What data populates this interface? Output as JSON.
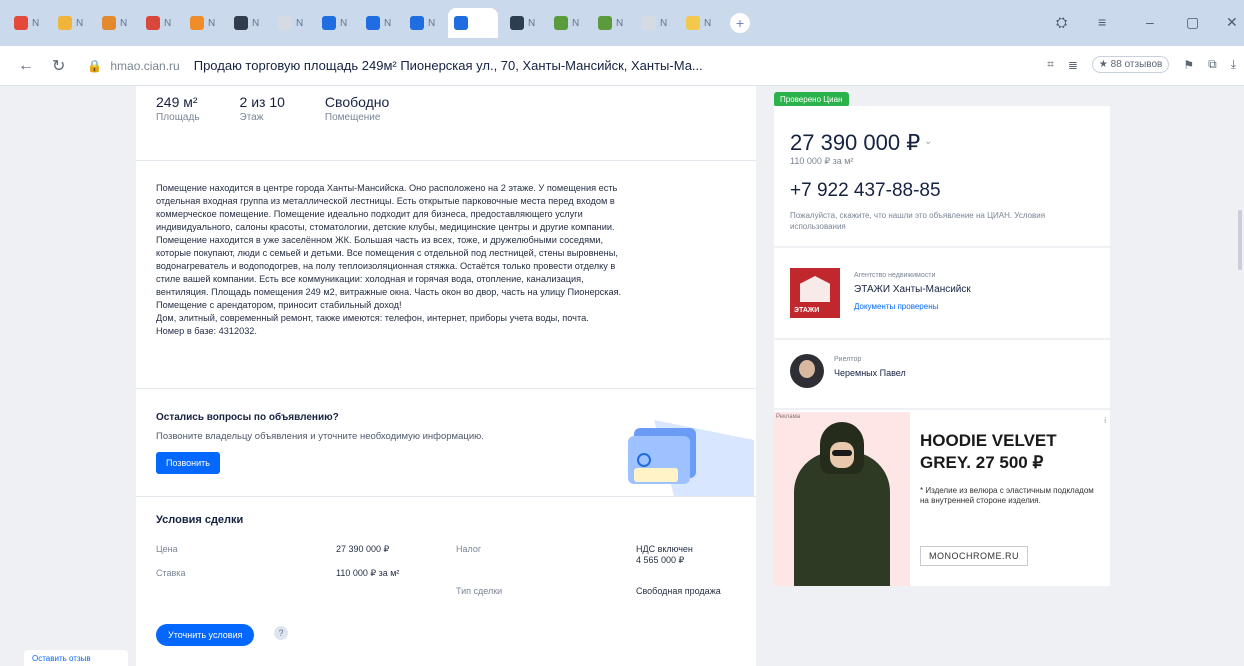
{
  "browser": {
    "tabs": [
      {
        "label": "N",
        "color": "#e34a3b"
      },
      {
        "label": "N",
        "color": "#f0b43a"
      },
      {
        "label": "N",
        "color": "#e38a2e"
      },
      {
        "label": "N",
        "color": "#d9473c"
      },
      {
        "label": "N",
        "color": "#f08c2a"
      },
      {
        "label": "N",
        "color": "#333c4f"
      },
      {
        "label": "N",
        "color": "#d6dbe3"
      },
      {
        "label": "N",
        "color": "#1f6de0"
      },
      {
        "label": "N",
        "color": "#1f6de0"
      },
      {
        "label": "N",
        "color": "#1f6de0"
      },
      {
        "label": "",
        "color": "#1f6de0",
        "active": true
      },
      {
        "label": "N",
        "color": "#2d3e52"
      },
      {
        "label": "N",
        "color": "#5b9b3b"
      },
      {
        "label": "N",
        "color": "#5b9b3b"
      },
      {
        "label": "N",
        "color": "#d6dbe3"
      },
      {
        "label": "N",
        "color": "#f2c94c"
      }
    ],
    "new_tab": "+",
    "domain": "hmao.cian.ru",
    "page_title": "Продаю торговую площадь 249м² Пионерская ул., 70, Ханты-Мансийск, Ханты-Ма...",
    "reviews_label": "★ 88 отзывов",
    "icons": {
      "back": "←",
      "reload": "↻",
      "lock": "🔒",
      "window_min": "–",
      "window_max": "▢",
      "window_close": "✕"
    }
  },
  "facts": [
    {
      "value": "249 м²",
      "label": "Площадь"
    },
    {
      "value": "2 из 10",
      "label": "Этаж"
    },
    {
      "value": "Свободно",
      "label": "Помещение"
    }
  ],
  "description": [
    "Помещение находится в центре города Ханты-Мансийска. Оно расположено на 2 этаже. У помещения есть",
    "отдельная входная группа из металлической лестницы. Есть открытые парковочные места перед входом в",
    "коммерческое помещение. Помещение идеально подходит для бизнеса, предоставляющего услуги",
    "индивидуального, салоны красоты, стоматологии, детские клубы, медицинские центры и другие компании.",
    "Помещение находится в уже заселённом ЖК. Большая часть из всех, тоже, и дружелюбными соседями,",
    "которые покупают, люди с семьей и детьми. Все помещения с отдельной под лестницей, стены выровнены,",
    "водонагреватель и водоподогрев, на полу теплоизоляционная стяжка. Остаётся только провести отделку в",
    "стиле вашей компании. Есть все коммуникации: холодная и горячая вода, отопление, канализация,",
    "вентиляция. Площадь помещения 249 м2, витражные окна. Часть окон во двор, часть на улицу Пионерская.",
    "Помещение с арендатором, приносит стабильный доход!",
    " Дом, элитный, современный ремонт, также имеются: телефон, интернет, приборы учета воды, почта.",
    "Номер в базе: 4312032."
  ],
  "questions": {
    "title": "Остались вопросы по объявлению?",
    "subtitle": "Позвоните владельцу объявления и уточните необходимую информацию.",
    "button": "Позвонить"
  },
  "deal": {
    "title": "Условия сделки",
    "rows": [
      {
        "label": "Цена",
        "value": "27 390 000 ₽"
      },
      {
        "label": "Налог",
        "value": "НДС включен\n4 565 000 ₽"
      },
      {
        "label": "Ставка",
        "value": "110 000 ₽ за м²"
      },
      {
        "label": "Тип сделки",
        "value": "Свободная продажа"
      }
    ],
    "button": "Уточнить условия",
    "help": "?"
  },
  "sidebar": {
    "badge": "Проверено Циан",
    "price": "27 390 000 ₽",
    "price_per_m2": "110 000 ₽ за м²",
    "phone": "+7 922 437-88-85",
    "phone_note": "Пожалуйста, скажите, что нашли это объявление на ЦИАН. Условия использования",
    "agency": {
      "small": "Агентство недвижимости",
      "name": "ЭТАЖИ Ханты-Мансийск",
      "docs": "Документы проверены",
      "logo_text": "ЭТАЖИ"
    },
    "agent": {
      "role": "Риелтор",
      "name": "Черемных Павел"
    }
  },
  "ad": {
    "tag": "Реклама",
    "title": "HOODIE VELVET GREY. 27 500 ₽",
    "desc": "* Изделие из велюра с эластичным подкладом на внутренней стороне изделия.",
    "button": "MONOCHROME.RU",
    "close": "i"
  },
  "feedback": "Оставить отзыв"
}
